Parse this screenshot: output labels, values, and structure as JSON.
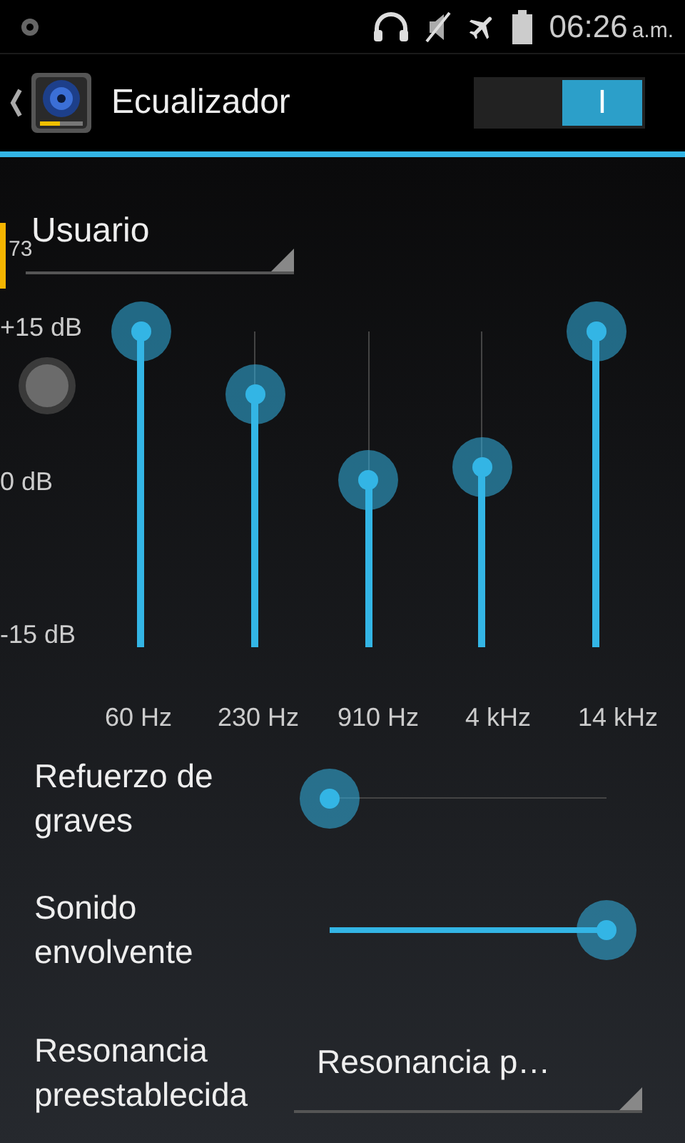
{
  "status_bar": {
    "time": "06:26",
    "meridiem": "a.m."
  },
  "action_bar": {
    "title": "Ecualizador",
    "switch": {
      "on": true,
      "label": "I"
    }
  },
  "overlay": {
    "counter": "73"
  },
  "preset": {
    "value": "Usuario"
  },
  "equalizer": {
    "db_labels": [
      "+15 dB",
      "0 dB",
      "-15 dB"
    ],
    "bands": [
      {
        "label": "60 Hz",
        "level": 1.0
      },
      {
        "label": "230 Hz",
        "level": 0.8
      },
      {
        "label": "910 Hz",
        "level": 0.53
      },
      {
        "label": "4 kHz",
        "level": 0.57
      },
      {
        "label": "14 kHz",
        "level": 1.0
      }
    ]
  },
  "effects": [
    {
      "label": "Refuerzo de graves",
      "level": 0.0
    },
    {
      "label": "Sonido envolvente",
      "level": 1.0
    }
  ],
  "reverb": {
    "label": "Resonancia preestablecida",
    "value": "Resonancia p…"
  }
}
